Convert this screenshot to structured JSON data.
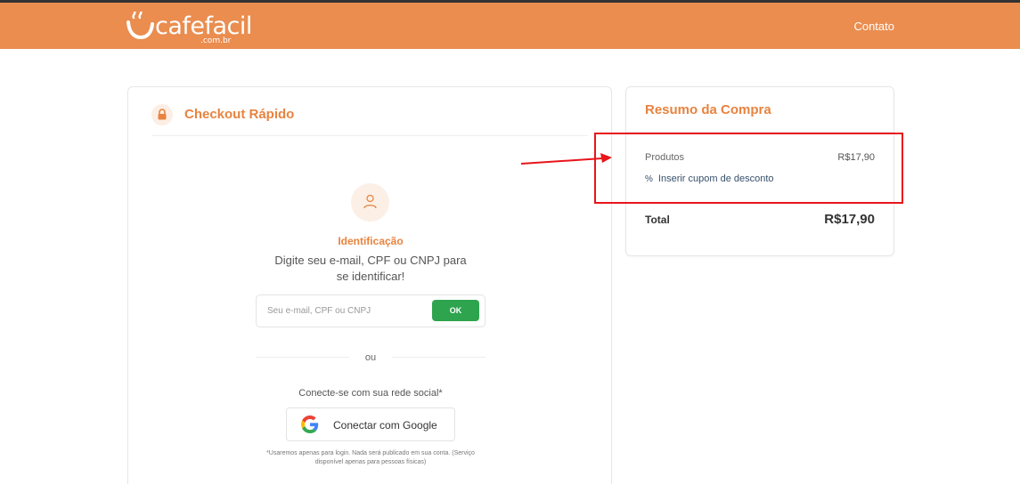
{
  "header": {
    "logo_text": "cafefacil",
    "logo_sub": ".com.br",
    "nav_contato": "Contato",
    "bg_color": "#ea8d4f"
  },
  "checkout": {
    "title": "Checkout Rápido",
    "lock_icon": "lock-icon",
    "identification": {
      "user_icon": "user-icon",
      "title": "Identificação",
      "description": "Digite seu e-mail, CPF ou CNPJ para se identificar!",
      "input_placeholder": "Seu e-mail, CPF ou CNPJ",
      "input_value": "",
      "ok_label": "OK"
    },
    "or_text": "ou",
    "social_label": "Conecte-se com sua rede social*",
    "google_label": "Conectar com Google",
    "disclaimer": "*Usaremos apenas para login. Nada será publicado em sua conta. (Serviço disponível apenas para pessoas físicas)"
  },
  "summary": {
    "title": "Resumo da Compra",
    "products_label": "Produtos",
    "products_value": "R$17,90",
    "coupon_icon": "percent-icon",
    "coupon_label": "Inserir cupom de desconto",
    "total_label": "Total",
    "total_value": "R$17,90"
  },
  "colors": {
    "accent": "#e8833f",
    "ok_button": "#2ea44f",
    "annotation_red": "#e8151b"
  }
}
